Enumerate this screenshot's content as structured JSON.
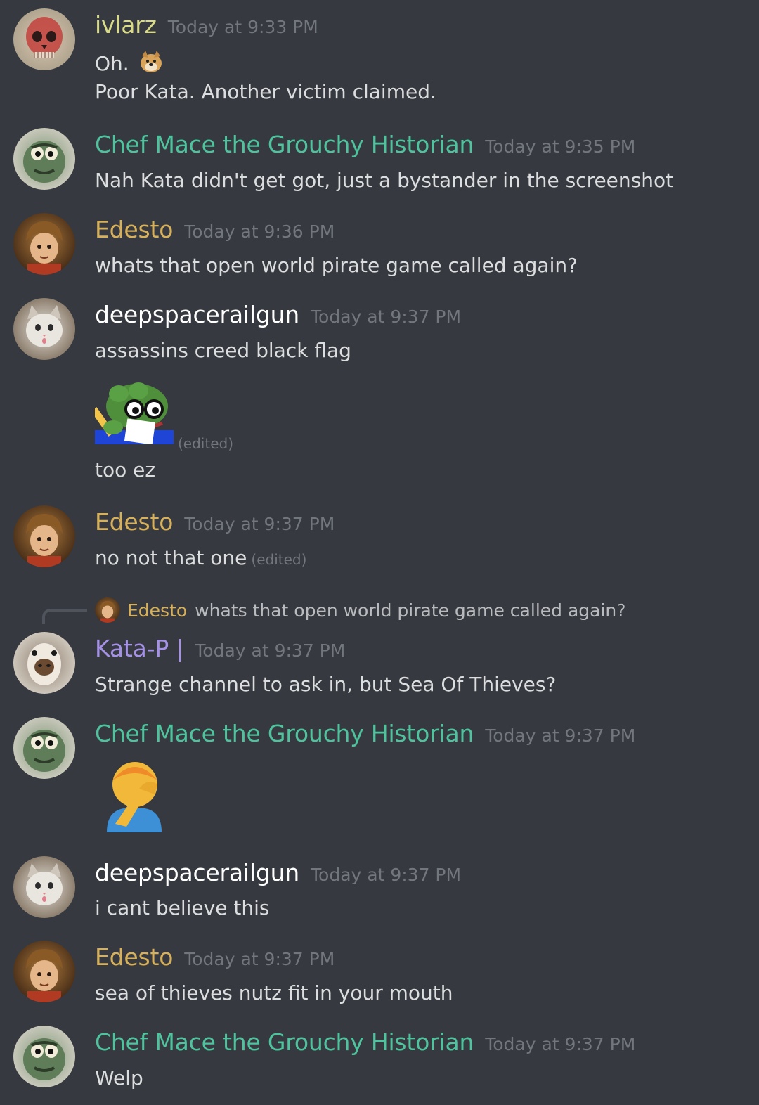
{
  "colors": {
    "background": "#36393f",
    "ivlarz": "#d8da86",
    "chef": "#4fc39d",
    "edesto": "#d6b05b",
    "deepspace": "#ffffff",
    "kata": "#a591e6",
    "timestamp": "#72767d",
    "message": "#dcddde"
  },
  "messages": [
    {
      "author": "ivlarz",
      "time": "Today at 9:33 PM",
      "avatar_icon": "skull-avatar-icon",
      "lines": [
        "Oh.",
        "Poor Kata. Another victim claimed."
      ],
      "inline_emoji": "doge-emoji-icon"
    },
    {
      "author": "Chef Mace the Grouchy Historian",
      "time": "Today at 9:35 PM",
      "avatar_icon": "oscar-grouch-avatar-icon",
      "lines": [
        "Nah Kata didn't get got, just a bystander in the screenshot"
      ]
    },
    {
      "author": "Edesto",
      "time": "Today at 9:36 PM",
      "avatar_icon": "edesto-avatar-icon",
      "lines": [
        "whats that open world pirate game called again?"
      ]
    },
    {
      "author": "deepspacerailgun",
      "time": "Today at 9:37 PM",
      "avatar_icon": "cat-avatar-icon",
      "lines": [
        "assassins creed black flag",
        "too ez"
      ],
      "emoji": "pepe-notes-emoji-icon",
      "edited_label": "(edited)"
    },
    {
      "author": "Edesto",
      "time": "Today at 9:37 PM",
      "avatar_icon": "edesto-avatar-icon",
      "lines": [
        "no not that one"
      ],
      "edited_label": "(edited)"
    },
    {
      "reply_to": {
        "author": "Edesto",
        "text": "whats that open world pirate game called again?"
      },
      "author": "Kata-P |",
      "time": "Today at 9:37 PM",
      "avatar_icon": "llama-avatar-icon",
      "lines": [
        "Strange channel to ask in, but Sea Of Thieves?"
      ]
    },
    {
      "author": "Chef Mace the Grouchy Historian",
      "time": "Today at 9:37 PM",
      "avatar_icon": "oscar-grouch-avatar-icon",
      "emoji": "facepalm-emoji-icon"
    },
    {
      "author": "deepspacerailgun",
      "time": "Today at 9:37 PM",
      "avatar_icon": "cat-avatar-icon",
      "lines": [
        "i cant believe this"
      ]
    },
    {
      "author": "Edesto",
      "time": "Today at 9:37 PM",
      "avatar_icon": "edesto-avatar-icon",
      "lines": [
        "sea of thieves nutz fit in your mouth"
      ]
    },
    {
      "author": "Chef Mace the Grouchy Historian",
      "time": "Today at 9:37 PM",
      "avatar_icon": "oscar-grouch-avatar-icon",
      "lines": [
        "Welp"
      ]
    }
  ]
}
